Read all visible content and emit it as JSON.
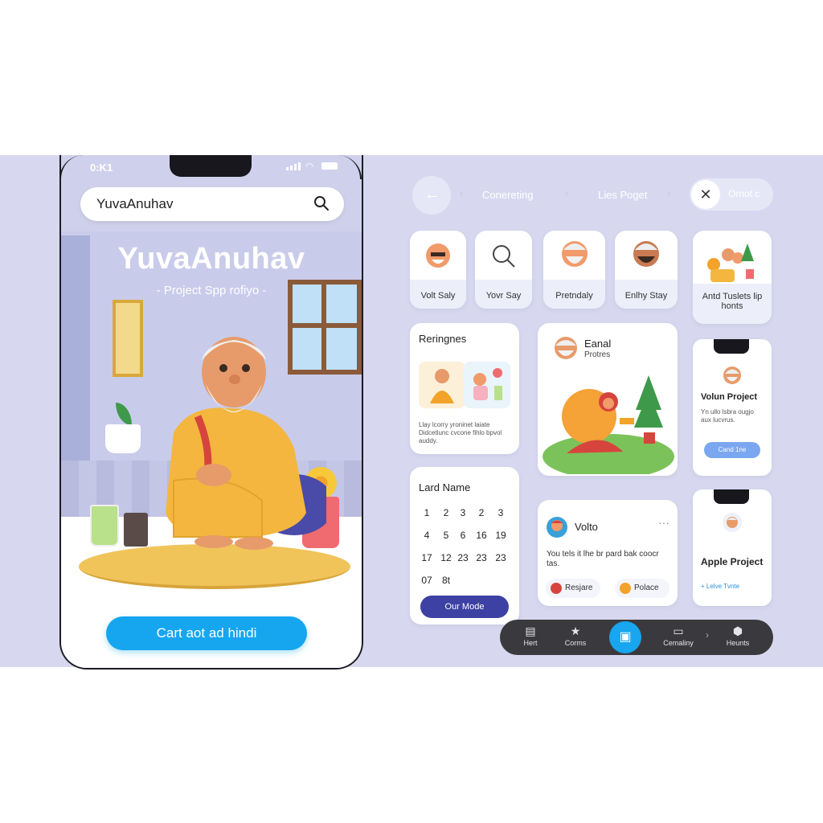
{
  "phone": {
    "status_time": "0:K1",
    "search_value": "YuvaAnuhav",
    "app_title": "YuvaAnuhav",
    "app_subtitle": "- Project Spp rofiyo -",
    "cta_label": "Cart aot ad hindi"
  },
  "topbar": {
    "crumbs": [
      "Conereting",
      "Lies Poget"
    ],
    "close_label": "Ornot c"
  },
  "tiles": [
    {
      "label": "Volt Saly"
    },
    {
      "label": "Yovr Say"
    },
    {
      "label": "Pretndaly"
    },
    {
      "label": "Enlhy Stay"
    },
    {
      "label": "Antd Tuslets lip honts"
    }
  ],
  "reringnes_card": {
    "title": "Reringnes",
    "body": "Llay lcorry yroninet laiate Didcetlunc cvcone fihlo bpvol auddy."
  },
  "profile_card": {
    "title": "Eanal",
    "subtitle": "Protres"
  },
  "volun_card": {
    "title": "Volun Project",
    "body": "Yn ullo lsbra ougjo aux lucvrus.",
    "button": "Cand 1ne"
  },
  "calendar_card": {
    "title": "Lard Name",
    "rows": [
      [
        "1",
        "2",
        "3",
        "2",
        "3"
      ],
      [
        "4",
        "5",
        "6",
        "16",
        "19"
      ],
      [
        "17",
        "12",
        "23",
        "23",
        "23"
      ],
      [
        "07",
        "8t"
      ]
    ],
    "button": "Our Mode"
  },
  "post_card": {
    "name": "Volto",
    "text": "You tels it lhe br pard bak coocr tas.",
    "chip_left": "Resjare",
    "chip_right": "Polace"
  },
  "apple_card": {
    "title": "Apple Project",
    "link": "+ Lelve Tvnte"
  },
  "nav": {
    "items": [
      {
        "label": "Hert",
        "icon": "calendar-icon"
      },
      {
        "label": "Corms",
        "icon": "star-icon"
      },
      {
        "label": "Cemaliny",
        "icon": "card-icon"
      },
      {
        "label": "Heunts",
        "icon": "cube-icon"
      }
    ]
  },
  "colors": {
    "band": "#d7d8ef",
    "accent_blue": "#15a6ef",
    "indigo_button": "#3c41a3",
    "nav_dark": "#3a3a3e"
  }
}
